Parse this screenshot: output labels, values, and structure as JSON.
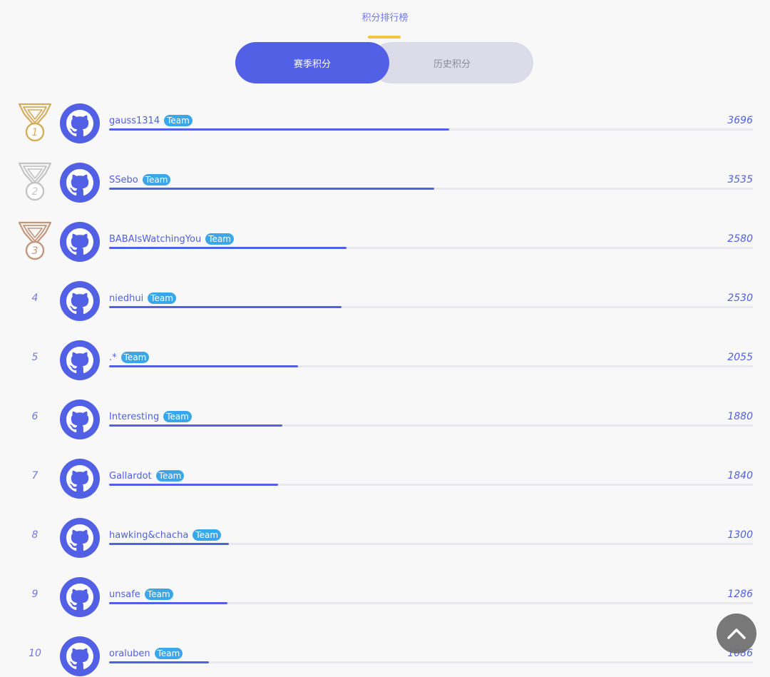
{
  "page": {
    "title": "积分排行榜",
    "accent_color": "#5160e4",
    "underline_color": "#f5c342",
    "team_badge_color": "#3ba7e8"
  },
  "tabs": [
    {
      "label": "赛季积分",
      "active": true
    },
    {
      "label": "历史积分",
      "active": false
    }
  ],
  "medals": [
    {
      "rank": "1",
      "color": "#d4ad5b",
      "icon": "gold-medal-icon"
    },
    {
      "rank": "2",
      "color": "#c4c4c4",
      "icon": "silver-medal-icon"
    },
    {
      "rank": "3",
      "color": "#c4967a",
      "icon": "bronze-medal-icon"
    }
  ],
  "leaderboard": {
    "max_score": 7000,
    "rows": [
      {
        "rank": "1",
        "name": "gauss1314",
        "badge": "Team",
        "score": "3696"
      },
      {
        "rank": "2",
        "name": "SSebo",
        "badge": "Team",
        "score": "3535"
      },
      {
        "rank": "3",
        "name": "BABAIsWatchingYou",
        "badge": "Team",
        "score": "2580"
      },
      {
        "rank": "4",
        "name": "niedhui",
        "badge": "Team",
        "score": "2530"
      },
      {
        "rank": "5",
        "name": ".*",
        "badge": "Team",
        "score": "2055"
      },
      {
        "rank": "6",
        "name": "Interesting",
        "badge": "Team",
        "score": "1880"
      },
      {
        "rank": "7",
        "name": "Gallardot",
        "badge": "Team",
        "score": "1840"
      },
      {
        "rank": "8",
        "name": "hawking&chacha",
        "badge": "Team",
        "score": "1300"
      },
      {
        "rank": "9",
        "name": "unsafe",
        "badge": "Team",
        "score": "1286"
      },
      {
        "rank": "10",
        "name": "oraluben",
        "badge": "Team",
        "score": "1086"
      }
    ]
  },
  "back_to_top": {
    "icon": "chevron-up-icon"
  }
}
